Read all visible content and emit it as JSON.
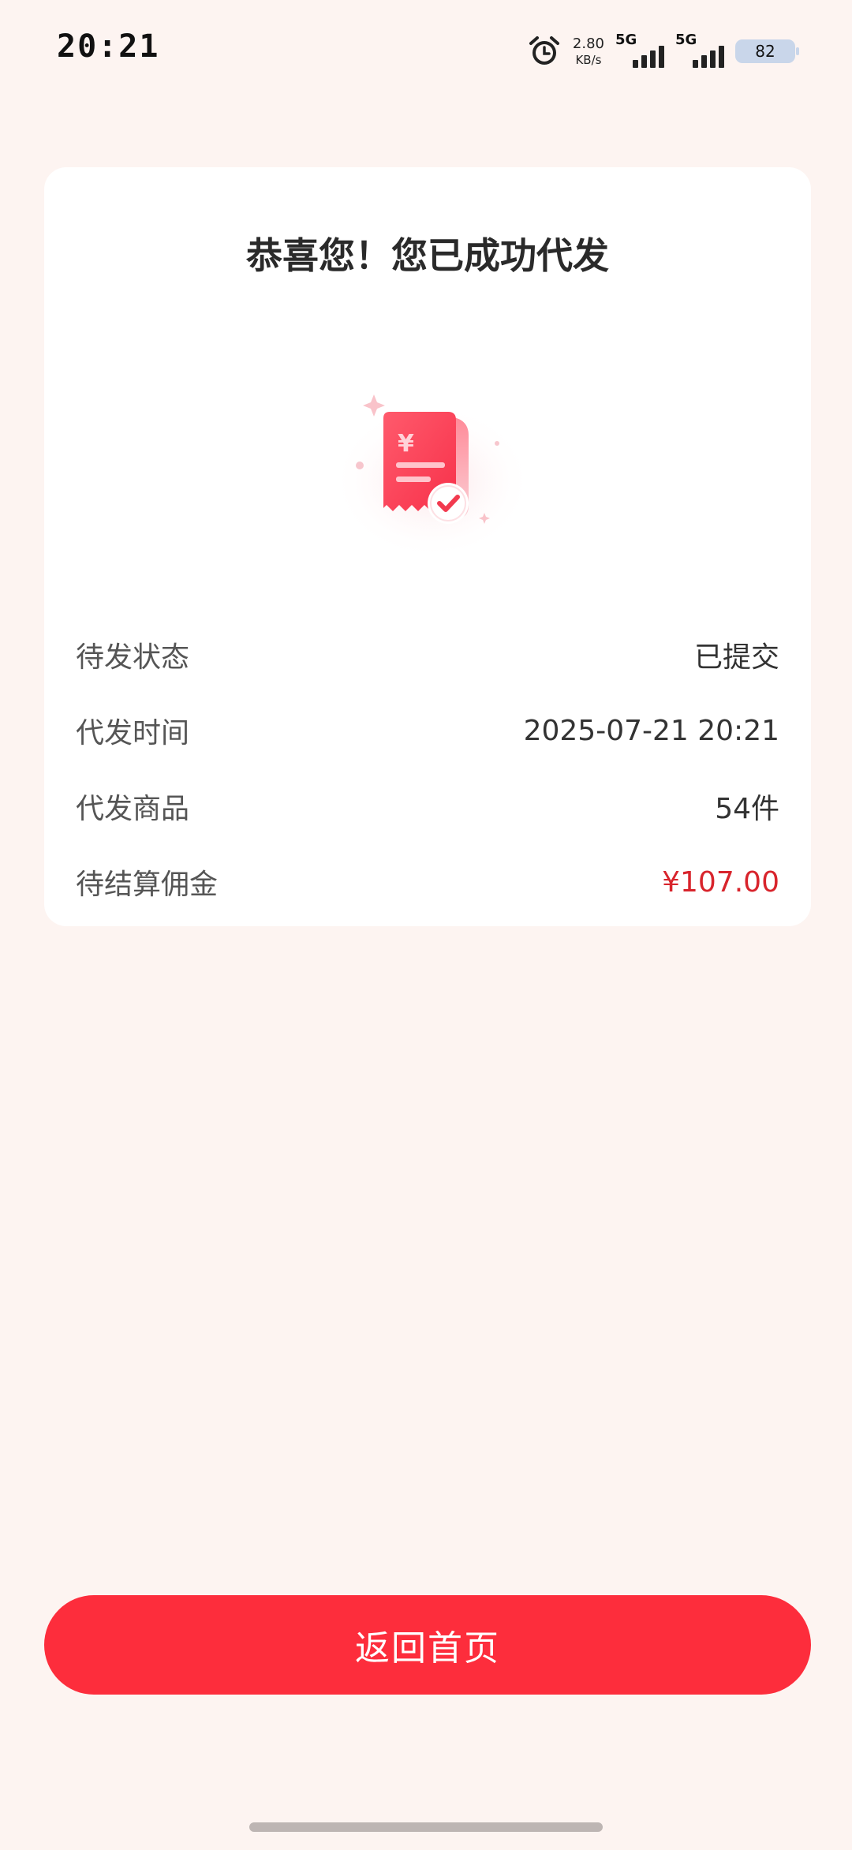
{
  "status_bar": {
    "time": "20:21",
    "net_speed_value": "2.80",
    "net_speed_unit": "KB/s",
    "sim1_label": "5G",
    "sim2_label": "5G",
    "battery_level": "82"
  },
  "card": {
    "title": "恭喜您！您已成功代发",
    "rows": [
      {
        "label": "待发状态",
        "value": "已提交"
      },
      {
        "label": "代发时间",
        "value": "2025-07-21 20:21"
      },
      {
        "label": "代发商品",
        "value": "54件"
      },
      {
        "label": "待结算佣金",
        "value": "¥107.00"
      }
    ]
  },
  "footer": {
    "home_button_label": "返回首页"
  },
  "colors": {
    "page_background": "#fdf4f1",
    "accent_red": "#fd2d3c",
    "money_red": "#d8242c"
  },
  "icons": {
    "alarm": "alarm-clock-icon",
    "illustration": "receipt-success-icon"
  }
}
